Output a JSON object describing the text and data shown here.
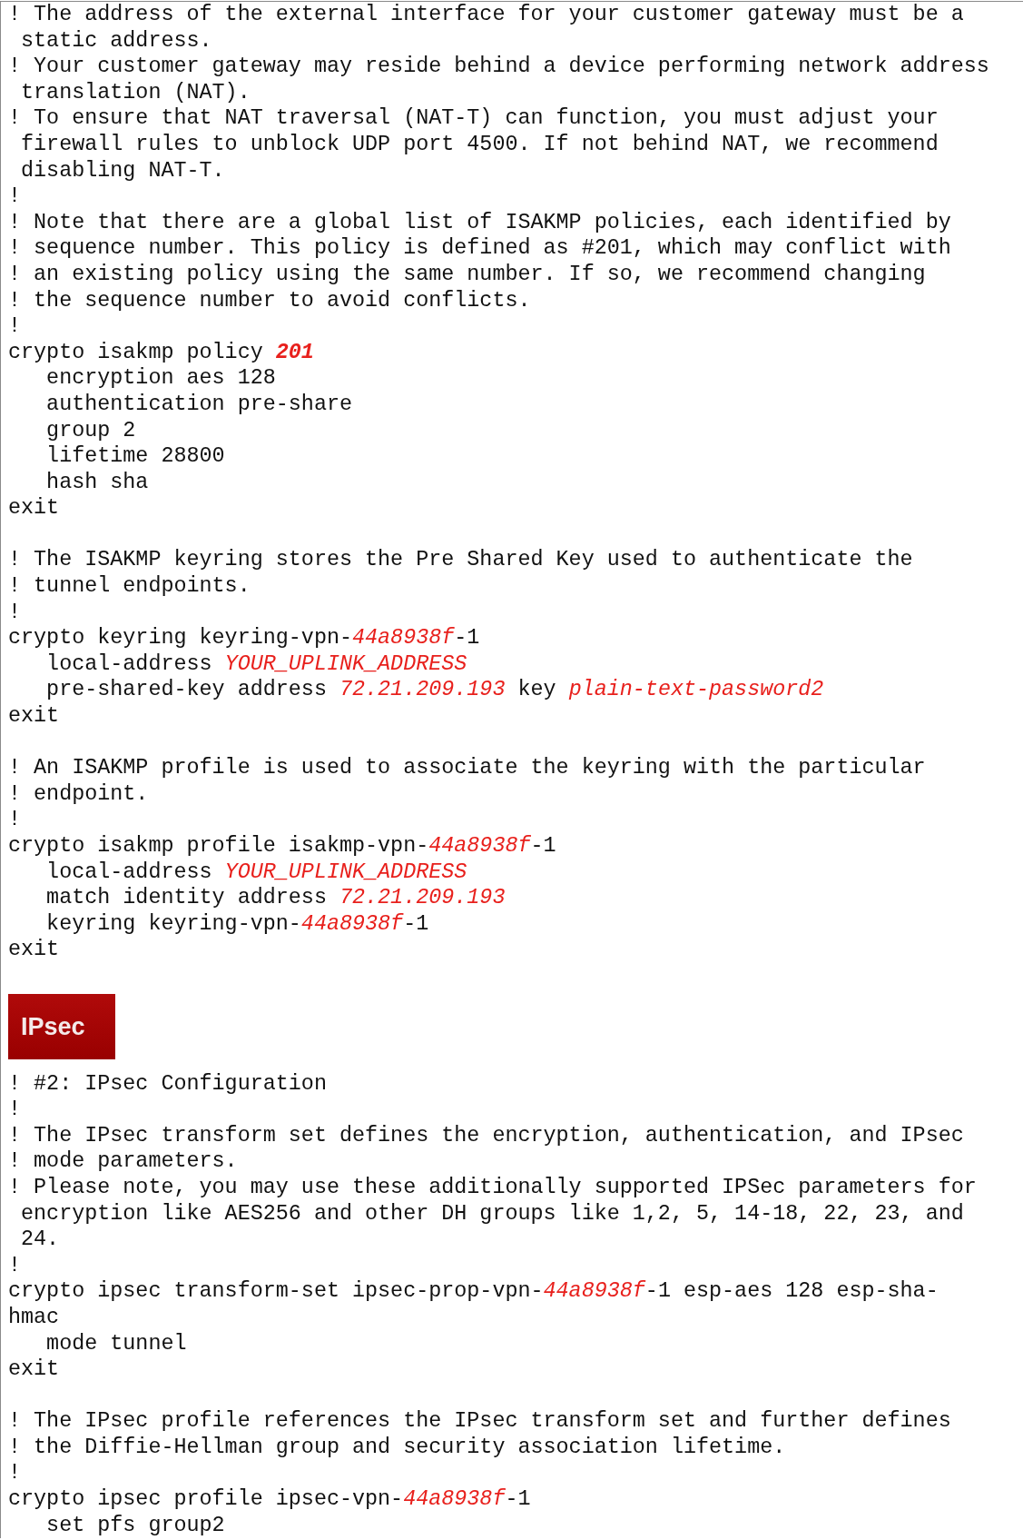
{
  "listing": [
    {
      "kind": "line",
      "parts": [
        {
          "kind": "plain",
          "text": "! The address of the external interface for your customer gateway must be a"
        }
      ]
    },
    {
      "kind": "line",
      "parts": [
        {
          "kind": "plain",
          "text": " static address."
        }
      ]
    },
    {
      "kind": "line",
      "parts": [
        {
          "kind": "plain",
          "text": "! Your customer gateway may reside behind a device performing network address"
        }
      ]
    },
    {
      "kind": "line",
      "parts": [
        {
          "kind": "plain",
          "text": " translation (NAT)."
        }
      ]
    },
    {
      "kind": "line",
      "parts": [
        {
          "kind": "plain",
          "text": "! To ensure that NAT traversal (NAT-T) can function, you must adjust your"
        }
      ]
    },
    {
      "kind": "line",
      "parts": [
        {
          "kind": "plain",
          "text": " firewall rules to unblock UDP port 4500. If not behind NAT, we recommend"
        }
      ]
    },
    {
      "kind": "line",
      "parts": [
        {
          "kind": "plain",
          "text": " disabling NAT-T."
        }
      ]
    },
    {
      "kind": "line",
      "parts": [
        {
          "kind": "plain",
          "text": "!"
        }
      ]
    },
    {
      "kind": "line",
      "parts": [
        {
          "kind": "plain",
          "text": "! Note that there are a global list of ISAKMP policies, each identified by"
        }
      ]
    },
    {
      "kind": "line",
      "parts": [
        {
          "kind": "plain",
          "text": "! sequence number. This policy is defined as #201, which may conflict with"
        }
      ]
    },
    {
      "kind": "line",
      "parts": [
        {
          "kind": "plain",
          "text": "! an existing policy using the same number. If so, we recommend changing"
        }
      ]
    },
    {
      "kind": "line",
      "parts": [
        {
          "kind": "plain",
          "text": "! the sequence number to avoid conflicts."
        }
      ]
    },
    {
      "kind": "line",
      "parts": [
        {
          "kind": "plain",
          "text": "!"
        }
      ]
    },
    {
      "kind": "line",
      "parts": [
        {
          "kind": "plain",
          "text": "crypto isakmp policy "
        },
        {
          "kind": "strong-variable",
          "text": "201"
        }
      ]
    },
    {
      "kind": "line",
      "parts": [
        {
          "kind": "plain",
          "text": "   encryption aes 128"
        }
      ]
    },
    {
      "kind": "line",
      "parts": [
        {
          "kind": "plain",
          "text": "   authentication pre-share"
        }
      ]
    },
    {
      "kind": "line",
      "parts": [
        {
          "kind": "plain",
          "text": "   group 2"
        }
      ]
    },
    {
      "kind": "line",
      "parts": [
        {
          "kind": "plain",
          "text": "   lifetime 28800"
        }
      ]
    },
    {
      "kind": "line",
      "parts": [
        {
          "kind": "plain",
          "text": "   hash sha"
        }
      ]
    },
    {
      "kind": "line",
      "parts": [
        {
          "kind": "plain",
          "text": "exit"
        }
      ]
    },
    {
      "kind": "blank"
    },
    {
      "kind": "line",
      "parts": [
        {
          "kind": "plain",
          "text": "! The ISAKMP keyring stores the Pre Shared Key used to authenticate the"
        }
      ]
    },
    {
      "kind": "line",
      "parts": [
        {
          "kind": "plain",
          "text": "! tunnel endpoints."
        }
      ]
    },
    {
      "kind": "line",
      "parts": [
        {
          "kind": "plain",
          "text": "!"
        }
      ]
    },
    {
      "kind": "line",
      "parts": [
        {
          "kind": "plain",
          "text": "crypto keyring keyring-vpn-"
        },
        {
          "kind": "variable",
          "text": "44a8938f"
        },
        {
          "kind": "plain",
          "text": "-1"
        }
      ]
    },
    {
      "kind": "line",
      "parts": [
        {
          "kind": "plain",
          "text": "   local-address "
        },
        {
          "kind": "variable",
          "text": "YOUR_UPLINK_ADDRESS"
        }
      ]
    },
    {
      "kind": "line",
      "parts": [
        {
          "kind": "plain",
          "text": "   pre-shared-key address "
        },
        {
          "kind": "variable",
          "text": "72.21.209.193"
        },
        {
          "kind": "plain",
          "text": " key "
        },
        {
          "kind": "variable",
          "text": "plain-text-password2"
        }
      ]
    },
    {
      "kind": "line",
      "parts": [
        {
          "kind": "plain",
          "text": "exit"
        }
      ]
    },
    {
      "kind": "blank"
    },
    {
      "kind": "line",
      "parts": [
        {
          "kind": "plain",
          "text": "! An ISAKMP profile is used to associate the keyring with the particular"
        }
      ]
    },
    {
      "kind": "line",
      "parts": [
        {
          "kind": "plain",
          "text": "! endpoint."
        }
      ]
    },
    {
      "kind": "line",
      "parts": [
        {
          "kind": "plain",
          "text": "!"
        }
      ]
    },
    {
      "kind": "line",
      "parts": [
        {
          "kind": "plain",
          "text": "crypto isakmp profile isakmp-vpn-"
        },
        {
          "kind": "variable",
          "text": "44a8938f"
        },
        {
          "kind": "plain",
          "text": "-1"
        }
      ]
    },
    {
      "kind": "line",
      "parts": [
        {
          "kind": "plain",
          "text": "   local-address "
        },
        {
          "kind": "variable",
          "text": "YOUR_UPLINK_ADDRESS"
        }
      ]
    },
    {
      "kind": "line",
      "parts": [
        {
          "kind": "plain",
          "text": "   match identity address "
        },
        {
          "kind": "variable",
          "text": "72.21.209.193"
        }
      ]
    },
    {
      "kind": "line",
      "parts": [
        {
          "kind": "plain",
          "text": "   keyring keyring-vpn-"
        },
        {
          "kind": "variable",
          "text": "44a8938f"
        },
        {
          "kind": "plain",
          "text": "-1"
        }
      ]
    },
    {
      "kind": "line",
      "parts": [
        {
          "kind": "plain",
          "text": "exit"
        }
      ]
    },
    {
      "kind": "blank"
    },
    {
      "kind": "logo",
      "text": "IPsec"
    },
    {
      "kind": "line",
      "parts": [
        {
          "kind": "plain",
          "text": "! #2: IPsec Configuration"
        }
      ]
    },
    {
      "kind": "line",
      "parts": [
        {
          "kind": "plain",
          "text": "!"
        }
      ]
    },
    {
      "kind": "line",
      "parts": [
        {
          "kind": "plain",
          "text": "! The IPsec transform set defines the encryption, authentication, and IPsec"
        }
      ]
    },
    {
      "kind": "line",
      "parts": [
        {
          "kind": "plain",
          "text": "! mode parameters."
        }
      ]
    },
    {
      "kind": "line",
      "parts": [
        {
          "kind": "plain",
          "text": "! Please note, you may use these additionally supported IPSec parameters for"
        }
      ]
    },
    {
      "kind": "line",
      "parts": [
        {
          "kind": "plain",
          "text": " encryption like AES256 and other DH groups like 1,2, 5, 14-18, 22, 23, and"
        }
      ]
    },
    {
      "kind": "line",
      "parts": [
        {
          "kind": "plain",
          "text": " 24."
        }
      ]
    },
    {
      "kind": "line",
      "parts": [
        {
          "kind": "plain",
          "text": "!"
        }
      ]
    },
    {
      "kind": "line",
      "parts": [
        {
          "kind": "plain",
          "text": "crypto ipsec transform-set ipsec-prop-vpn-"
        },
        {
          "kind": "variable",
          "text": "44a8938f"
        },
        {
          "kind": "plain",
          "text": "-1 esp-aes 128 esp-sha-"
        }
      ]
    },
    {
      "kind": "line",
      "parts": [
        {
          "kind": "plain",
          "text": "hmac"
        }
      ]
    },
    {
      "kind": "line",
      "parts": [
        {
          "kind": "plain",
          "text": "   mode tunnel"
        }
      ]
    },
    {
      "kind": "line",
      "parts": [
        {
          "kind": "plain",
          "text": "exit"
        }
      ]
    },
    {
      "kind": "blank"
    },
    {
      "kind": "line",
      "parts": [
        {
          "kind": "plain",
          "text": "! The IPsec profile references the IPsec transform set and further defines"
        }
      ]
    },
    {
      "kind": "line",
      "parts": [
        {
          "kind": "plain",
          "text": "! the Diffie-Hellman group and security association lifetime."
        }
      ]
    },
    {
      "kind": "line",
      "parts": [
        {
          "kind": "plain",
          "text": "!"
        }
      ]
    },
    {
      "kind": "line",
      "parts": [
        {
          "kind": "plain",
          "text": "crypto ipsec profile ipsec-vpn-"
        },
        {
          "kind": "variable",
          "text": "44a8938f"
        },
        {
          "kind": "plain",
          "text": "-1"
        }
      ]
    },
    {
      "kind": "line",
      "parts": [
        {
          "kind": "plain",
          "text": "   set pfs group2"
        }
      ]
    }
  ]
}
